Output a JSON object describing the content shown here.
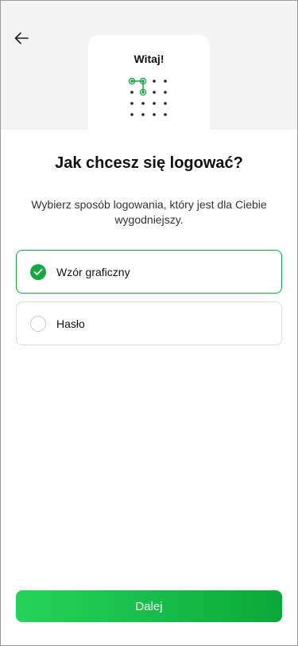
{
  "header": {
    "back_icon": "arrow-left-icon"
  },
  "illustration": {
    "greeting": "Witaj!",
    "accent_color": "#1aa23f"
  },
  "main": {
    "title": "Jak chcesz się logować?",
    "subtitle": "Wybierz sposób logowania, który jest dla Ciebie wygodniejszy.",
    "options": [
      {
        "label": "Wzór graficzny",
        "selected": true
      },
      {
        "label": "Hasło",
        "selected": false
      }
    ]
  },
  "footer": {
    "next_label": "Dalej"
  },
  "colors": {
    "primary": "#17a745",
    "border": "#dcdcdc"
  }
}
